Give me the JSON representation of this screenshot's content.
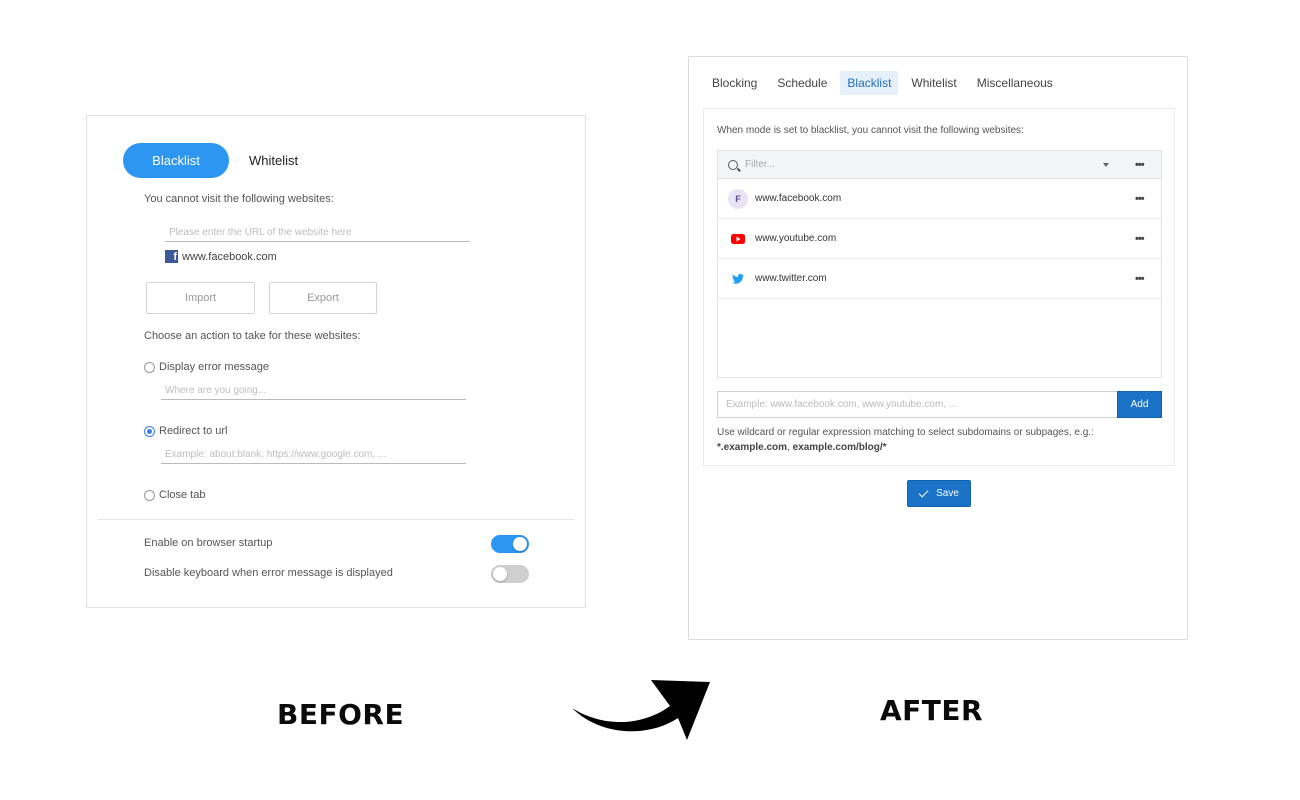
{
  "before": {
    "caption": "BEFORE",
    "tabs": {
      "blacklist": "Blacklist",
      "whitelist": "Whitelist"
    },
    "cannot_visit_label": "You cannot visit the following websites:",
    "url_input_placeholder": "Please enter the URL of the website here",
    "site": {
      "icon": "facebook-icon",
      "name": "www.facebook.com"
    },
    "import_label": "Import",
    "export_label": "Export",
    "action_label": "Choose an action to take for these websites:",
    "options": {
      "display_error": {
        "label": "Display error message",
        "placeholder": "Where are you going...",
        "selected": false
      },
      "redirect": {
        "label": "Redirect to url",
        "placeholder": "Example: about:blank, https://www.google.com, ...",
        "selected": true
      },
      "close_tab": {
        "label": "Close tab",
        "selected": false
      }
    },
    "settings": {
      "startup": {
        "label": "Enable on browser startup",
        "on": true
      },
      "keyboard": {
        "label": "Disable keyboard when error message is displayed",
        "on": false
      }
    }
  },
  "after": {
    "caption": "AFTER",
    "tabs": [
      "Blocking",
      "Schedule",
      "Blacklist",
      "Whitelist",
      "Miscellaneous"
    ],
    "active_tab": "Blacklist",
    "description": "When mode is set to blacklist, you cannot visit the following websites:",
    "filter_placeholder": "Filter...",
    "sites": [
      {
        "icon": "facebook-letter-icon",
        "letter": "F",
        "url": "www.facebook.com"
      },
      {
        "icon": "youtube-icon",
        "url": "www.youtube.com"
      },
      {
        "icon": "twitter-icon",
        "url": "www.twitter.com"
      }
    ],
    "add_placeholder": "Example: www.facebook.com, www.youtube.com, ...",
    "add_label": "Add",
    "hint_text": "Use wildcard or regular expression matching to select subdomains or subpages, e.g.:",
    "hint_examples": {
      "first": "*.example.com",
      "sep": ", ",
      "second": "example.com/blog/*"
    },
    "save_label": "Save"
  },
  "colors": {
    "before_accent": "#2d96f2",
    "after_accent": "#1a73c7",
    "youtube_red": "#ff0000",
    "twitter_blue": "#1da1f2",
    "facebook_blue": "#3b5998"
  },
  "arrow_icon": "curved-arrow-right-icon"
}
